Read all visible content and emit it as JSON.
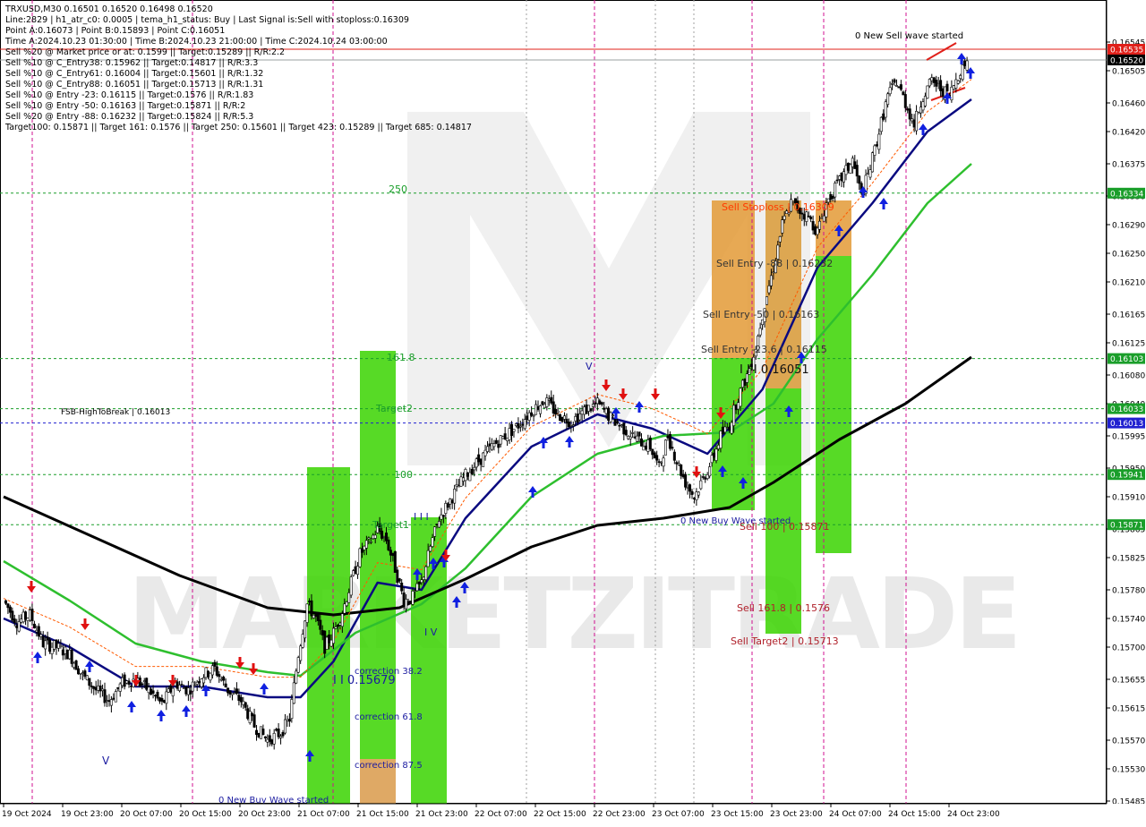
{
  "header": {
    "symbol_line": "TRXUSD,M30  0.16501 0.16520 0.16498 0.16520",
    "info_lines": [
      "Line:2829  |  h1_atr_c0: 0.0005  |  tema_h1_status: Buy  |  Last Signal is:Sell with stoploss:0.16309",
      "Point A:0.16073  |  Point B:0.15893  |  Point C:0.16051",
      "Time A:2024.10.23 01:30:00  |  Time B:2024.10.23 21:00:00  |  Time C:2024.10.24 03:00:00",
      "Sell %20 @ Market price or at: 0.1599  ||  Target:0.15289  ||  R/R:2.2",
      "Sell %10 @ C_Entry38: 0.15962  ||  Target:0.14817  ||  R/R:3.3",
      "Sell %10 @ C_Entry61: 0.16004  ||  Target:0.15601  ||  R/R:1.32",
      "Sell %10 @ C_Entry88: 0.16051  ||  Target:0.15713  ||  R/R:1.31",
      "Sell %10 @ Entry -23: 0.16115  ||  Target:0.1576  ||  R/R:1.83",
      "Sell %10 @ Entry -50: 0.16163  ||  Target:0.15871  ||  R/R:2",
      "Sell %20 @ Entry -88: 0.16232  ||  Target:0.15824  ||  R/R:5.3",
      "Target100: 0.15871  ||  Target 161: 0.1576  ||  Target 250: 0.15601  ||  Target 423: 0.15289  ||  Target 685: 0.14817"
    ]
  },
  "watermark": "MARKETZITRADE",
  "price_tags": [
    {
      "label": "0.16535",
      "value": 0.16535,
      "color": "#e0201a"
    },
    {
      "label": "0.16520",
      "value": 0.1652,
      "color": "#000000"
    },
    {
      "label": "0.16334",
      "value": 0.16334,
      "color": "#1a9e2a"
    },
    {
      "label": "0.16103",
      "value": 0.16103,
      "color": "#1a9e2a"
    },
    {
      "label": "0.16033",
      "value": 0.16033,
      "color": "#1a9e2a"
    },
    {
      "label": "0.16013",
      "value": 0.16013,
      "color": "#2020d0"
    },
    {
      "label": "0.15941",
      "value": 0.15941,
      "color": "#1a9e2a"
    },
    {
      "label": "0.15871",
      "value": 0.15871,
      "color": "#1a9e2a"
    }
  ],
  "chart_labels": [
    {
      "text": "0 New Sell wave started",
      "color": "#000000"
    },
    {
      "text": "250",
      "color": "#1a9e2a"
    },
    {
      "text": "Sell Stoploss | 0.16309",
      "color": "#ff3a00"
    },
    {
      "text": "Sell Entry -88 | 0.16232",
      "color": "#333333"
    },
    {
      "text": "Sell Entry -50 | 0.16163",
      "color": "#333333"
    },
    {
      "text": "Sell Entry -23.6 | 0.16115",
      "color": "#333333"
    },
    {
      "text": "I I I 0.16051",
      "color": "#111111"
    },
    {
      "text": "161.8",
      "color": "#1a9e2a"
    },
    {
      "text": "Target2",
      "color": "#1a9e2a"
    },
    {
      "text": "FSB-HighToBreak  |  0.16013",
      "color": "#000000"
    },
    {
      "text": "100",
      "color": "#1a9e2a"
    },
    {
      "text": "Target1",
      "color": "#1a9e2a"
    },
    {
      "text": "0 New Buy Wave started",
      "color": "#1a1aa0"
    },
    {
      "text": "Sell 100 | 0.15871",
      "color": "#b0202a"
    },
    {
      "text": "Sell 161.8 | 0.1576",
      "color": "#b0202a"
    },
    {
      "text": "Sell Target2 | 0.15713",
      "color": "#b0202a"
    },
    {
      "text": "correction 38.2",
      "color": "#1a1aa0"
    },
    {
      "text": "I I 0.15679",
      "color": "#1a1aa0"
    },
    {
      "text": "correction 61.8",
      "color": "#1a1aa0"
    },
    {
      "text": "correction 87.5",
      "color": "#1a1aa0"
    },
    {
      "text": "0 New Buy Wave started",
      "color": "#1a1aa0"
    },
    {
      "text": "I I I",
      "color": "#1a1aa0"
    },
    {
      "text": "V",
      "color": "#1a1aa0"
    },
    {
      "text": "I V",
      "color": "#1a1aa0"
    },
    {
      "text": "V",
      "color": "#1a1aa0"
    }
  ],
  "chart_data": {
    "type": "candlestick",
    "symbol": "TRXUSD",
    "timeframe": "M30",
    "ylim": [
      0.15485,
      0.16565
    ],
    "y_ticks": [
      0.16545,
      0.16505,
      0.1646,
      0.1642,
      0.16375,
      0.1633,
      0.1629,
      0.1625,
      0.1621,
      0.16165,
      0.16125,
      0.1608,
      0.1604,
      0.15995,
      0.1595,
      0.1591,
      0.15865,
      0.15825,
      0.1578,
      0.1574,
      0.157,
      0.15655,
      0.15615,
      0.1557,
      0.1553,
      0.15485
    ],
    "y_tick_labels": [
      "0.16545",
      "0.16505",
      "0.16460",
      "0.16420",
      "0.16375",
      "0.16330",
      "0.16290",
      "0.16250",
      "0.16210",
      "0.16165",
      "0.16125",
      "0.16080",
      "0.16040",
      "0.15995",
      "0.15950",
      "0.15910",
      "0.15865",
      "0.15825",
      "0.15780",
      "0.15740",
      "0.15700",
      "0.15655",
      "0.15615",
      "0.15570",
      "0.15530",
      "0.15485"
    ],
    "x_tick_labels": [
      "19 Oct 2024",
      "19 Oct 23:00",
      "20 Oct 07:00",
      "20 Oct 15:00",
      "20 Oct 23:00",
      "21 Oct 07:00",
      "21 Oct 15:00",
      "21 Oct 23:00",
      "22 Oct 07:00",
      "22 Oct 15:00",
      "22 Oct 23:00",
      "23 Oct 07:00",
      "23 Oct 15:00",
      "23 Oct 23:00",
      "24 Oct 07:00",
      "24 Oct 15:00",
      "24 Oct 23:00"
    ],
    "close_path": [
      [
        0,
        0.15765
      ],
      [
        6,
        0.15735
      ],
      [
        12,
        0.15745
      ],
      [
        18,
        0.15705
      ],
      [
        24,
        0.157
      ],
      [
        30,
        0.1569
      ],
      [
        36,
        0.1566
      ],
      [
        42,
        0.1564
      ],
      [
        48,
        0.15625
      ],
      [
        54,
        0.1565
      ],
      [
        60,
        0.15655
      ],
      [
        66,
        0.1564
      ],
      [
        72,
        0.1562
      ],
      [
        78,
        0.1565
      ],
      [
        84,
        0.1564
      ],
      [
        90,
        0.1566
      ],
      [
        96,
        0.1567
      ],
      [
        102,
        0.1564
      ],
      [
        108,
        0.15625
      ],
      [
        114,
        0.1559
      ],
      [
        120,
        0.1557
      ],
      [
        126,
        0.1558
      ],
      [
        130,
        0.156
      ],
      [
        134,
        0.1569
      ],
      [
        138,
        0.1576
      ],
      [
        142,
        0.1574
      ],
      [
        146,
        0.157
      ],
      [
        150,
        0.1572
      ],
      [
        154,
        0.1575
      ],
      [
        158,
        0.1579
      ],
      [
        162,
        0.1583
      ],
      [
        166,
        0.15845
      ],
      [
        170,
        0.15865
      ],
      [
        174,
        0.1585
      ],
      [
        178,
        0.1581
      ],
      [
        182,
        0.15765
      ],
      [
        186,
        0.1577
      ],
      [
        190,
        0.1579
      ],
      [
        194,
        0.1584
      ],
      [
        198,
        0.1588
      ],
      [
        204,
        0.1591
      ],
      [
        210,
        0.1594
      ],
      [
        216,
        0.1596
      ],
      [
        222,
        0.1598
      ],
      [
        228,
        0.15995
      ],
      [
        234,
        0.1601
      ],
      [
        240,
        0.1603
      ],
      [
        246,
        0.16045
      ],
      [
        252,
        0.16025
      ],
      [
        258,
        0.16015
      ],
      [
        264,
        0.1603
      ],
      [
        270,
        0.1604
      ],
      [
        276,
        0.1602
      ],
      [
        282,
        0.16005
      ],
      [
        288,
        0.1599
      ],
      [
        294,
        0.1598
      ],
      [
        298,
        0.1595
      ],
      [
        302,
        0.15995
      ],
      [
        306,
        0.1596
      ],
      [
        310,
        0.1593
      ],
      [
        314,
        0.1591
      ],
      [
        318,
        0.15935
      ],
      [
        322,
        0.1596
      ],
      [
        326,
        0.15995
      ],
      [
        330,
        0.1601
      ],
      [
        334,
        0.1605
      ],
      [
        338,
        0.1608
      ],
      [
        342,
        0.1612
      ],
      [
        346,
        0.1618
      ],
      [
        350,
        0.1623
      ],
      [
        354,
        0.1629
      ],
      [
        358,
        0.1632
      ],
      [
        362,
        0.1631
      ],
      [
        366,
        0.163
      ],
      [
        370,
        0.1628
      ],
      [
        374,
        0.1632
      ],
      [
        378,
        0.1634
      ],
      [
        382,
        0.1636
      ],
      [
        386,
        0.1638
      ],
      [
        390,
        0.1633
      ],
      [
        394,
        0.1637
      ],
      [
        398,
        0.1642
      ],
      [
        402,
        0.1647
      ],
      [
        406,
        0.1649
      ],
      [
        410,
        0.1646
      ],
      [
        414,
        0.1643
      ],
      [
        418,
        0.1647
      ],
      [
        422,
        0.1649
      ],
      [
        426,
        0.1648
      ],
      [
        430,
        0.1647
      ],
      [
        434,
        0.165
      ],
      [
        438,
        0.1652
      ]
    ],
    "series": [
      {
        "name": "MA fast",
        "color": "#0a0a80",
        "values": [
          [
            0,
            0.1574
          ],
          [
            30,
            0.157
          ],
          [
            60,
            0.15645
          ],
          [
            90,
            0.15645
          ],
          [
            120,
            0.1563
          ],
          [
            135,
            0.1563
          ],
          [
            150,
            0.1568
          ],
          [
            170,
            0.1579
          ],
          [
            190,
            0.1578
          ],
          [
            210,
            0.1588
          ],
          [
            240,
            0.1598
          ],
          [
            270,
            0.16025
          ],
          [
            295,
            0.16005
          ],
          [
            320,
            0.1597
          ],
          [
            345,
            0.1606
          ],
          [
            370,
            0.1623
          ],
          [
            395,
            0.1632
          ],
          [
            420,
            0.1642
          ],
          [
            440,
            0.16465
          ]
        ]
      },
      {
        "name": "MA mid",
        "color": "#2ebf2e",
        "values": [
          [
            0,
            0.1582
          ],
          [
            30,
            0.15765
          ],
          [
            60,
            0.15705
          ],
          [
            90,
            0.1568
          ],
          [
            120,
            0.15665
          ],
          [
            135,
            0.1566
          ],
          [
            160,
            0.1572
          ],
          [
            190,
            0.1576
          ],
          [
            210,
            0.1581
          ],
          [
            240,
            0.1591
          ],
          [
            270,
            0.1597
          ],
          [
            300,
            0.15995
          ],
          [
            330,
            0.16
          ],
          [
            350,
            0.1604
          ],
          [
            370,
            0.1613
          ],
          [
            395,
            0.1622
          ],
          [
            420,
            0.1632
          ],
          [
            440,
            0.16375
          ]
        ]
      },
      {
        "name": "MA slow",
        "color": "#000000",
        "values": [
          [
            0,
            0.1591
          ],
          [
            40,
            0.15855
          ],
          [
            80,
            0.158
          ],
          [
            120,
            0.15755
          ],
          [
            150,
            0.15745
          ],
          [
            180,
            0.15755
          ],
          [
            210,
            0.15795
          ],
          [
            240,
            0.1584
          ],
          [
            270,
            0.1587
          ],
          [
            300,
            0.1588
          ],
          [
            330,
            0.15895
          ],
          [
            350,
            0.1593
          ],
          [
            380,
            0.1599
          ],
          [
            410,
            0.1604
          ],
          [
            440,
            0.16105
          ]
        ]
      }
    ]
  }
}
